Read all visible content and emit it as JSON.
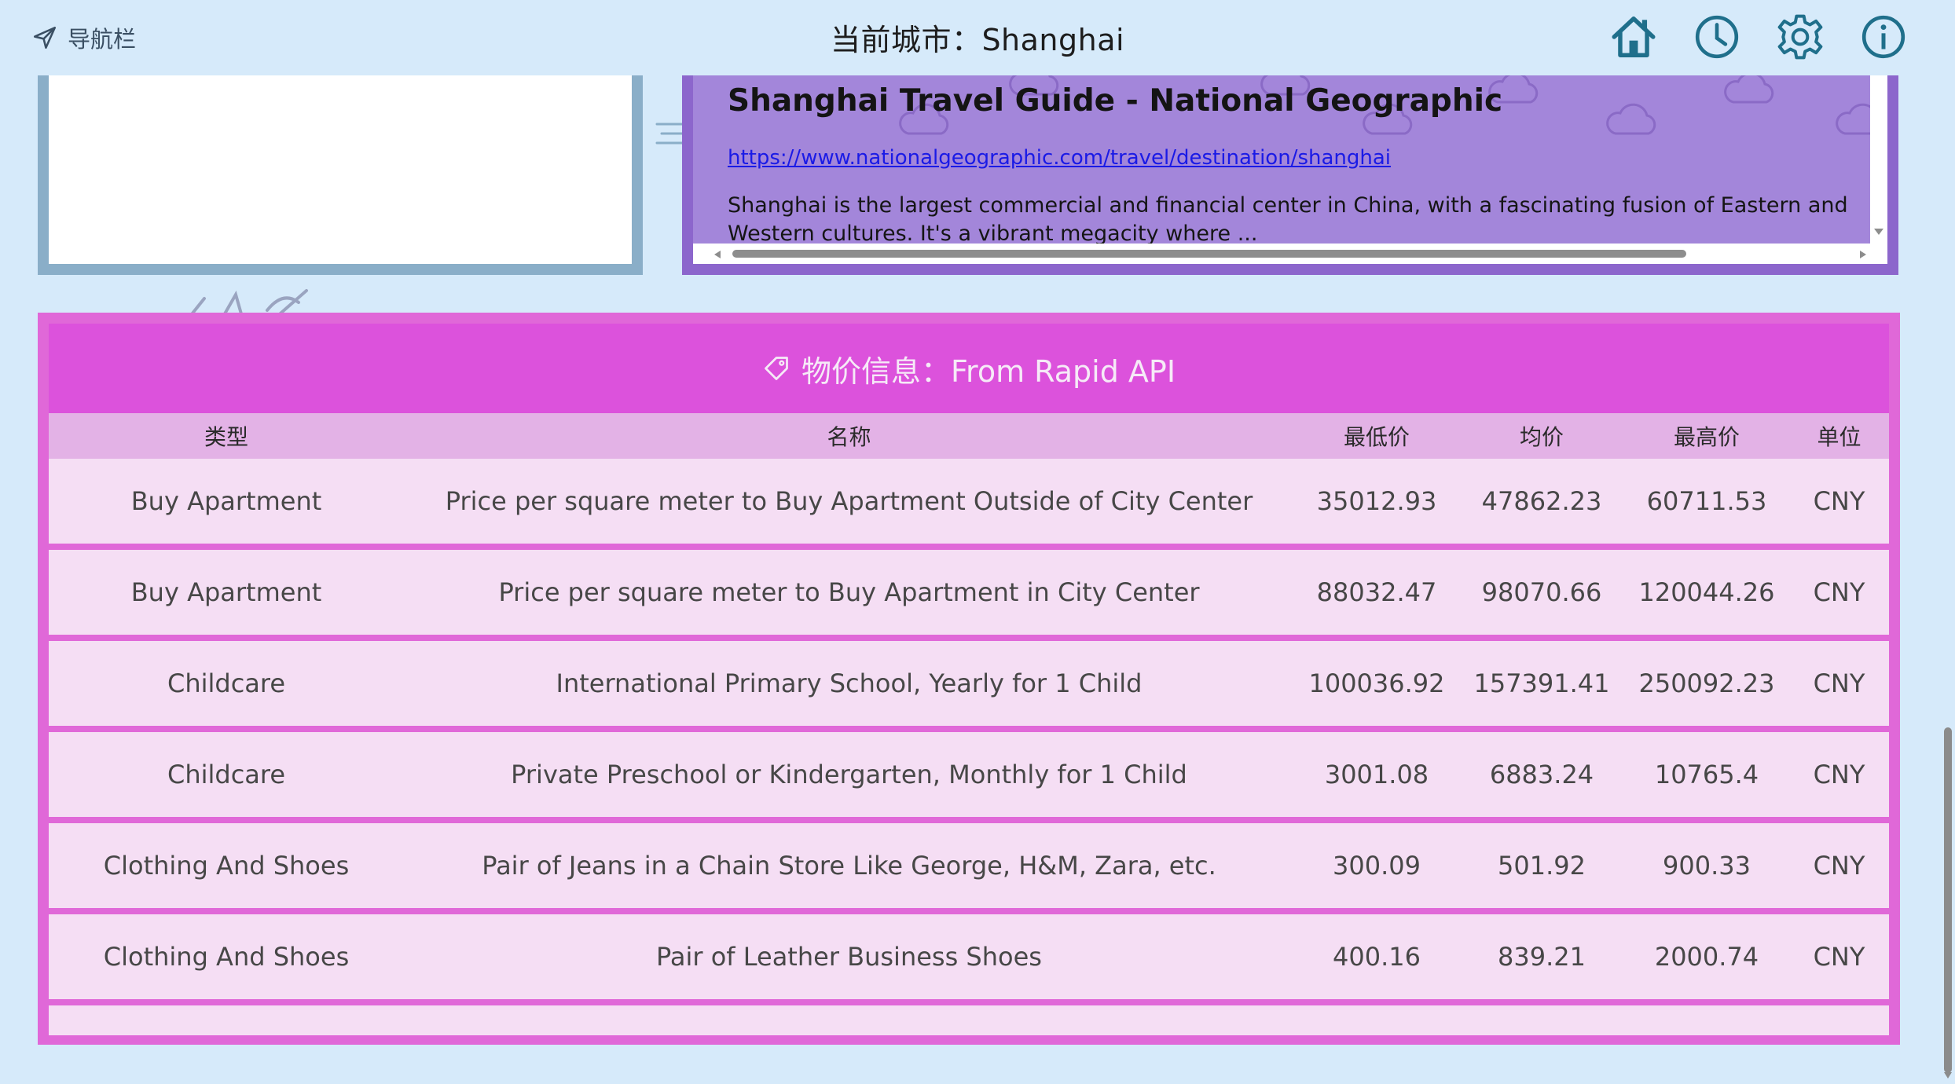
{
  "topbar": {
    "nav_label": "导航栏",
    "city_title": "当前城市：Shanghai",
    "icons": [
      "home-icon",
      "history-clock-icon",
      "settings-gear-icon",
      "info-icon"
    ]
  },
  "guide": {
    "title": "Shanghai Travel Guide - National Geographic",
    "url": "https://www.nationalgeographic.com/travel/destination/shanghai",
    "description": "Shanghai is the largest commercial and financial center in China, with a fascinating fusion of Eastern and Western cultures. It's a vibrant megacity where ..."
  },
  "prices": {
    "header": "物价信息：From Rapid API",
    "columns": [
      "类型",
      "名称",
      "最低价",
      "均价",
      "最高价",
      "单位"
    ],
    "rows": [
      [
        "Buy Apartment",
        "Price per square meter to Buy Apartment Outside of City Center",
        "35012.93",
        "47862.23",
        "60711.53",
        "CNY"
      ],
      [
        "Buy Apartment",
        "Price per square meter to Buy Apartment in City Center",
        "88032.47",
        "98070.66",
        "120044.26",
        "CNY"
      ],
      [
        "Childcare",
        "International Primary School, Yearly for 1 Child",
        "100036.92",
        "157391.41",
        "250092.23",
        "CNY"
      ],
      [
        "Childcare",
        "Private Preschool or Kindergarten, Monthly for 1 Child",
        "3001.08",
        "6883.24",
        "10765.4",
        "CNY"
      ],
      [
        "Clothing And Shoes",
        "Pair of Jeans in a Chain Store Like George, H&M, Zara, etc.",
        "300.09",
        "501.92",
        "900.33",
        "CNY"
      ],
      [
        "Clothing And Shoes",
        "Pair of Leather Business Shoes",
        "400.16",
        "839.21",
        "2000.74",
        "CNY"
      ]
    ]
  },
  "colors": {
    "background": "#d6eafa",
    "guide_panel": "#9c7fd6",
    "price_panel": "#e068d8",
    "price_header": "#dc52dc",
    "table_row": "#f5def4",
    "table_head": "#e3b2e6",
    "icon_teal": "#1f6f8b"
  }
}
